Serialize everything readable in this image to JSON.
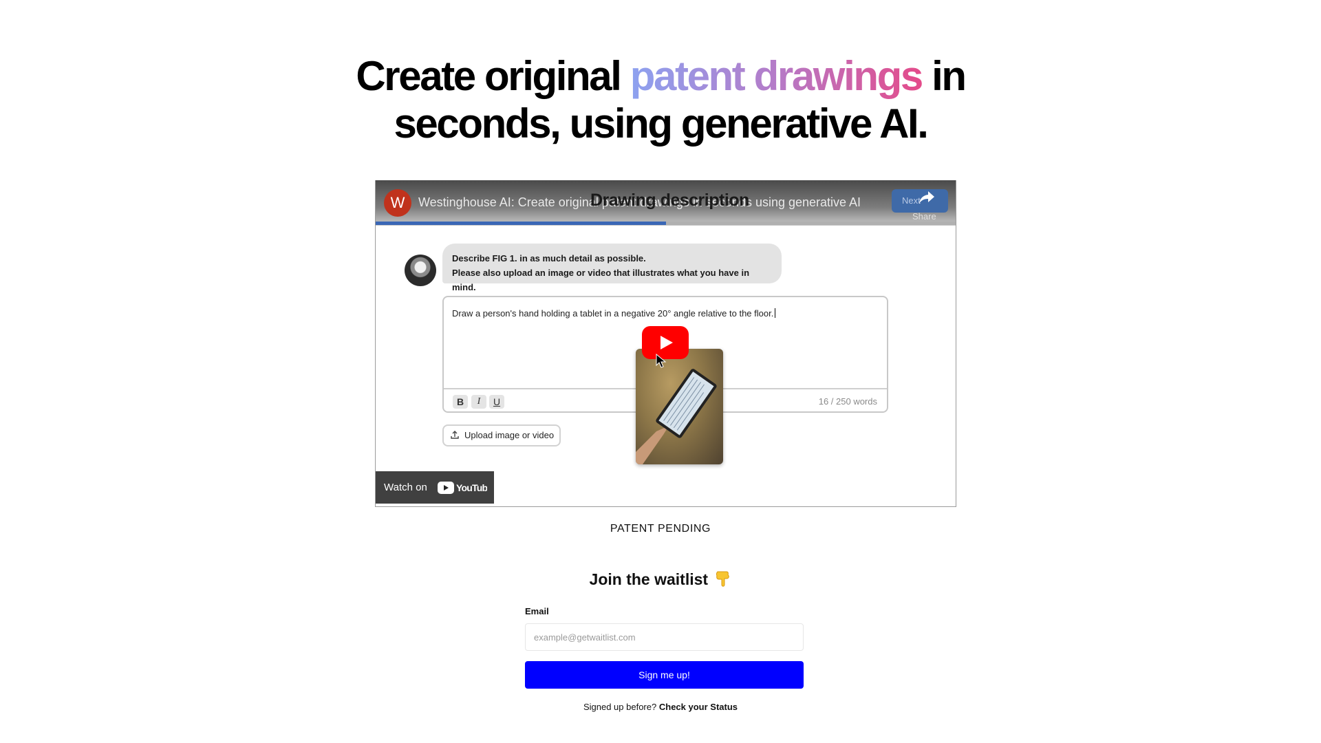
{
  "hero": {
    "title_before": "Create original ",
    "title_highlight": "patent drawings",
    "title_after": " in",
    "title_line2": "seconds, using generative AI.",
    "gradient_colors": [
      "#8da2f0",
      "#b57bc8",
      "#e44b8a"
    ]
  },
  "video": {
    "channel_initial": "W",
    "title": "Westinghouse AI: Create original patent drawings in seconds using generative AI",
    "overlay_heading": "Drawing description",
    "next_label": "Next",
    "share_label": "Share",
    "progress_fraction": 0.5,
    "prompt_line1": "Describe FIG 1. in as much detail as possible.",
    "prompt_line2": "Please also upload an image or video that illustrates what you have in mind.",
    "editor_text": "Draw a person's hand holding a tablet in a negative 20° angle relative to the floor.",
    "bold_label": "B",
    "italic_label": "I",
    "underline_label": "U",
    "word_count": "16 / 250 words",
    "upload_label": "Upload image or video",
    "watch_on_label": "Watch on",
    "youtube_brand": "YouTube",
    "youtube_red": "#ff0000"
  },
  "patent_pending": "PATENT PENDING",
  "waitlist": {
    "title": "Join the waitlist",
    "email_label": "Email",
    "email_placeholder": "example@getwaitlist.com",
    "email_value": "",
    "submit_label": "Sign me up!",
    "submit_color": "#0000ff",
    "signed_up_text": "Signed up before?",
    "status_link": "Check your Status"
  }
}
